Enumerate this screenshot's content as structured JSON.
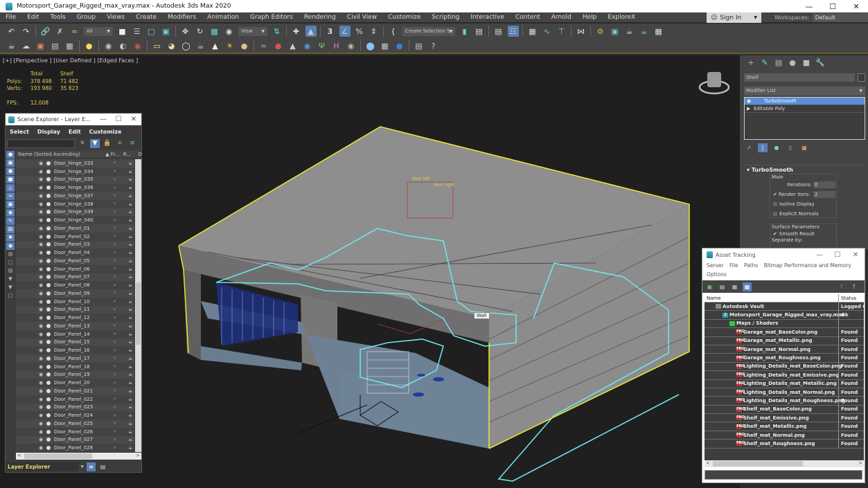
{
  "window": {
    "title": "Motorsport_Garage_Rigged_max_vray.max - Autodesk 3ds Max 2020",
    "controls": [
      "minimize",
      "maximize",
      "close"
    ]
  },
  "menubar": {
    "items": [
      "File",
      "Edit",
      "Tools",
      "Group",
      "Views",
      "Create",
      "Modifiers",
      "Animation",
      "Graph Editors",
      "Rendering",
      "Civil View",
      "Customize",
      "Scripting",
      "Interactive",
      "Content",
      "Arnold",
      "Help",
      "ExploreX"
    ],
    "sign_in": "Sign In",
    "workspaces_label": "Workspaces:",
    "workspaces_value": "Default"
  },
  "toolbar1": {
    "selection_filter": "All",
    "ref_coord": "View",
    "named_selection": "Create Selection Se",
    "icons": [
      "undo-icon",
      "redo-icon",
      "link-icon",
      "unlink-icon",
      "bind-space-warp-icon",
      "select-object-icon",
      "select-by-name-icon",
      "rect-selection-icon",
      "window-crossing-icon",
      "move-icon",
      "rotate-icon",
      "scale-icon",
      "place-icon",
      "pivot-icon",
      "keyboard-shortcut-icon",
      "snap-3d-icon",
      "angle-snap-icon",
      "percent-snap-icon",
      "spinner-snap-icon",
      "edit-named-sets-icon",
      "mirror-icon",
      "align-icon",
      "layer-explorer-icon",
      "scene-explorer-icon",
      "toggle-ribbon-icon",
      "curve-editor-icon",
      "schematic-view-icon",
      "material-editor-icon",
      "render-setup-icon",
      "rendered-frame-icon",
      "render-icon",
      "render-iterative-icon",
      "viewport-layout-icon"
    ]
  },
  "toolbar2": {
    "icons": [
      "teapot-icon",
      "cloud-icon",
      "bitmap-icon",
      "table-icon",
      "grid-icon",
      "light-icon",
      "camera-icon",
      "sphere-light-icon",
      "vray-icon",
      "plane-light-icon",
      "dome-light-icon",
      "sphere-icon",
      "teapot-small-icon",
      "ies-light-icon",
      "sun-icon",
      "disc-icon",
      "fur-icon",
      "material-icon",
      "mesh-icon",
      "globe-icon",
      "grass-icon",
      "hf-icon",
      "displace-icon",
      "material-ball-icon",
      "convert-icon",
      "vfb-icon",
      "clipboard-icon",
      "help-icon"
    ]
  },
  "viewport": {
    "label": "[+] [Perspective ] [User Defined ] [Edged Faces ]",
    "stats": {
      "col_total": "Total",
      "col_shelf": "Shelf",
      "polys_label": "Polys:",
      "polys_total": "378 498",
      "polys_shelf": "71 482",
      "verts_label": "Verts:",
      "verts_total": "193 980",
      "verts_shelf": "35 823",
      "fps_label": "FPS:",
      "fps_value": "12.008"
    },
    "tooltip": "Wall",
    "helpers": [
      "door left",
      "door right"
    ]
  },
  "scene_explorer": {
    "title": "Scene Explorer - Layer E...",
    "menu": [
      "Select",
      "Display",
      "Edit",
      "Customize"
    ],
    "columns": [
      "Name (Sorted Ascending)",
      "▲ Fr...",
      "R...",
      "D"
    ],
    "rows": [
      "Door_hinge_033",
      "Door_hinge_034",
      "Door_hinge_035",
      "Door_hinge_036",
      "Door_hinge_037",
      "Door_hinge_038",
      "Door_hinge_039",
      "Door_hinge_040",
      "Door_Panel_01",
      "Door_Panel_02",
      "Door_Panel_03",
      "Door_Panel_04",
      "Door_Panel_05",
      "Door_Panel_06",
      "Door_Panel_07",
      "Door_Panel_08",
      "Door_Panel_09",
      "Door_Panel_10",
      "Door_Panel_11",
      "Door_Panel_12",
      "Door_Panel_13",
      "Door_Panel_14",
      "Door_Panel_15",
      "Door_Panel_16",
      "Door_Panel_17",
      "Door_Panel_18",
      "Door_Panel_19",
      "Door_Panel_20",
      "Door_Panel_021",
      "Door_Panel_022",
      "Door_Panel_023",
      "Door_Panel_024",
      "Door_Panel_025",
      "Door_Panel_026",
      "Door_Panel_027",
      "Door_Panel_028"
    ],
    "footer_dropdown": "Layer Explorer"
  },
  "command_panel": {
    "object_name": "Shelf",
    "modifier_list": "Modifier List",
    "stack": [
      "TurboSmooth",
      "Editable Poly"
    ],
    "rollout_title": "TurboSmooth",
    "main_group": "Main",
    "iterations_label": "Iterations:",
    "iterations_value": "0",
    "render_iters_label": "Render Iters:",
    "render_iters_value": "2",
    "render_iters_checked": true,
    "isoline_display": "Isoline Display",
    "isoline_checked": false,
    "explicit_normals": "Explicit Normals",
    "explicit_checked": false,
    "surface_group": "Surface Parameters",
    "smooth_result": "Smooth Result",
    "smooth_checked": true,
    "separate_by": "Separate by:"
  },
  "asset_tracking": {
    "title": "Asset Tracking",
    "menu": [
      "Server",
      "File",
      "Paths",
      "Bitmap Performance and Memory",
      "Options"
    ],
    "columns": [
      "Name",
      "Status"
    ],
    "rows": [
      {
        "name": "Autodesk Vault",
        "status": "Logged O",
        "level": 0,
        "icon": "vault"
      },
      {
        "name": "Motorsport_Garage_Rigged_max_vray.max",
        "status": "Ok",
        "level": 1,
        "icon": "max"
      },
      {
        "name": "Maps / Shaders",
        "status": "",
        "level": 2,
        "icon": "maps"
      },
      {
        "name": "Garage_mat_BaseColor.png",
        "status": "Found",
        "level": 3,
        "icon": "png"
      },
      {
        "name": "Garage_mat_Metallic.png",
        "status": "Found",
        "level": 3,
        "icon": "png"
      },
      {
        "name": "Garage_mat_Normal.png",
        "status": "Found",
        "level": 3,
        "icon": "png"
      },
      {
        "name": "Garage_mat_Roughness.png",
        "status": "Found",
        "level": 3,
        "icon": "png"
      },
      {
        "name": "Lighting_Details_mat_BaseColor.png",
        "status": "Found",
        "level": 3,
        "icon": "png"
      },
      {
        "name": "Lighting_Details_mat_Emissive.png",
        "status": "Found",
        "level": 3,
        "icon": "png"
      },
      {
        "name": "Lighting_Details_mat_Metallic.png",
        "status": "Found",
        "level": 3,
        "icon": "png"
      },
      {
        "name": "Lighting_Details_mat_Normal.png",
        "status": "Found",
        "level": 3,
        "icon": "png"
      },
      {
        "name": "Lighting_Details_mat_Roughness.png",
        "status": "Found",
        "level": 3,
        "icon": "png"
      },
      {
        "name": "Shelf_mat_BaseColor.png",
        "status": "Found",
        "level": 3,
        "icon": "png"
      },
      {
        "name": "Shelf_mat_Emissive.png",
        "status": "Found",
        "level": 3,
        "icon": "png"
      },
      {
        "name": "Shelf_mat_Metallic.png",
        "status": "Found",
        "level": 3,
        "icon": "png"
      },
      {
        "name": "Shelf_mat_Normal.png",
        "status": "Found",
        "level": 3,
        "icon": "png"
      },
      {
        "name": "Shelf_mat_Roughness.png",
        "status": "Found",
        "level": 3,
        "icon": "png"
      }
    ]
  },
  "colors": {
    "accent": "#5b7fb5",
    "selection_highlight": "#6fe3e8",
    "selected_wire": "#f4f12a",
    "stats_text": "#e2cf5a"
  }
}
